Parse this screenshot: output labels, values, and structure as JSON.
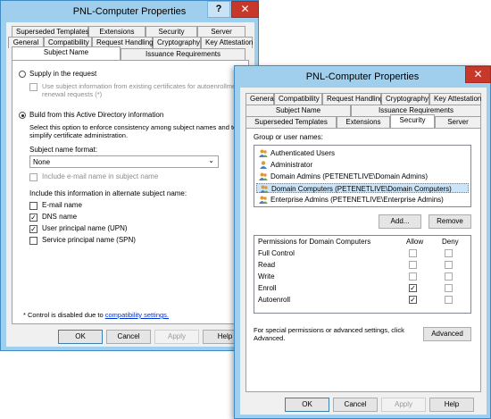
{
  "back": {
    "title": "PNL-Computer Properties",
    "help": "?",
    "close": "✕",
    "tabs_row1": [
      "Superseded Templates",
      "Extensions",
      "Security",
      "Server"
    ],
    "tabs_row2": [
      "General",
      "Compatibility",
      "Request Handling",
      "Cryptography",
      "Key Attestation"
    ],
    "tabs_row3": [
      "Subject Name",
      "Issuance Requirements"
    ],
    "supply_label": "Supply in the request",
    "use_subject_info": "Use subject information from existing certificates for autoenrollment",
    "use_subject_info2": "renewal requests (*)",
    "build_label": "Build from this Active Directory information",
    "build_desc1": "Select this option to enforce consistency among subject names and to",
    "build_desc2": "simplify certificate administration.",
    "format_label": "Subject name format:",
    "format_value": "None",
    "include_email_subject": "Include e-mail name in subject name",
    "alt_label": "Include this information in alternate subject name:",
    "alt_items": [
      "E-mail name",
      "DNS name",
      "User principal name (UPN)",
      "Service principal name (SPN)"
    ],
    "note_prefix": "* Control is disabled due to ",
    "note_link": "compatibility settings.",
    "ok": "OK",
    "cancel": "Cancel",
    "apply": "Apply",
    "help_btn": "Help"
  },
  "front": {
    "title": "PNL-Computer Properties",
    "close": "✕",
    "tabs_row1": [
      "General",
      "Compatibility",
      "Request Handling",
      "Cryptography",
      "Key Attestation"
    ],
    "tabs_row2": [
      "Subject Name",
      "Issuance Requirements"
    ],
    "tabs_row3": [
      "Superseded Templates",
      "Extensions",
      "Security",
      "Server"
    ],
    "group_label": "Group or user names:",
    "users": [
      "Authenticated Users",
      "Administrator",
      "Domain Admins (PETENETLIVE\\Domain Admins)",
      "Domain Computers (PETENETLIVE\\Domain Computers)",
      "Enterprise Admins (PETENETLIVE\\Enterprise Admins)"
    ],
    "add": "Add...",
    "remove": "Remove",
    "perm_header": "Permissions for Domain Computers",
    "allow": "Allow",
    "deny": "Deny",
    "perms": [
      "Full Control",
      "Read",
      "Write",
      "Enroll",
      "Autoenroll"
    ],
    "special1": "For special permissions or advanced settings, click",
    "special2": "Advanced.",
    "advanced": "Advanced",
    "ok": "OK",
    "cancel": "Cancel",
    "apply": "Apply",
    "help_btn": "Help"
  }
}
